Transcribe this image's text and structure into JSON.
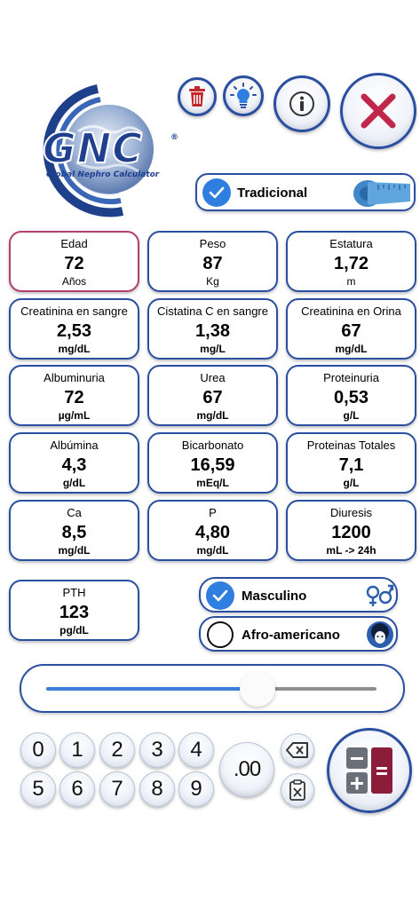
{
  "logo": {
    "letters": "GNC",
    "tagline": "Global Nephro Calculator",
    "reg": "®"
  },
  "toolbar": {
    "delete_icon": "trash-icon",
    "tips_icon": "lightbulb-icon",
    "info_icon": "info-icon",
    "close_icon": "close-icon"
  },
  "mode": {
    "label": "Tradicional",
    "checked": true,
    "icon": "measuring-tape-icon"
  },
  "fields": [
    {
      "label": "Edad",
      "value": "72",
      "unit": "Años"
    },
    {
      "label": "Peso",
      "value": "87",
      "unit": "Kg"
    },
    {
      "label": "Estatura",
      "value": "1,72",
      "unit": "m"
    },
    {
      "label": "Creatinina en sangre",
      "value": "2,53",
      "unit": "mg/dL"
    },
    {
      "label": "Cistatina C en sangre",
      "value": "1,38",
      "unit": "mg/L"
    },
    {
      "label": "Creatinina en Orina",
      "value": "67",
      "unit": "mg/dL"
    },
    {
      "label": "Albuminuria",
      "value": "72",
      "unit": "µg/mL"
    },
    {
      "label": "Urea",
      "value": "67",
      "unit": "mg/dL"
    },
    {
      "label": "Proteinuria",
      "value": "0,53",
      "unit": "g/L"
    },
    {
      "label": "Albúmina",
      "value": "4,3",
      "unit": "g/dL"
    },
    {
      "label": "Bicarbonato",
      "value": "16,59",
      "unit": "mEq/L"
    },
    {
      "label": "Proteinas Totales",
      "value": "7,1",
      "unit": "g/L"
    },
    {
      "label": "Ca",
      "value": "8,5",
      "unit": "mg/dL"
    },
    {
      "label": "P",
      "value": "4,80",
      "unit": "mg/dL"
    },
    {
      "label": "Diuresis",
      "value": "1200",
      "unit": "mL -> 24h"
    },
    {
      "label": "PTH",
      "value": "123",
      "unit": "pg/dL"
    }
  ],
  "sex": {
    "label": "Masculino",
    "checked": true,
    "icon": "gender-icon"
  },
  "race": {
    "label": "Afro-americano",
    "checked": false,
    "icon": "afro-person-icon"
  },
  "slider": {
    "value_fraction": 0.64
  },
  "numpad": {
    "digits": [
      "0",
      "1",
      "2",
      "3",
      "4",
      "5",
      "6",
      "7",
      "8",
      "9"
    ],
    "decimal": ".00",
    "backspace_icon": "backspace-icon",
    "clear_icon": "clear-clipboard-icon",
    "calc_icon": "calculator-icon"
  },
  "colors": {
    "border_blue": "#2b4fa0",
    "active_border": "#b04070",
    "check_blue": "#2f7fe0",
    "slider_fill": "#3b7dd8",
    "delete_red": "#c1272d",
    "calc_red": "#8b1c3a"
  }
}
